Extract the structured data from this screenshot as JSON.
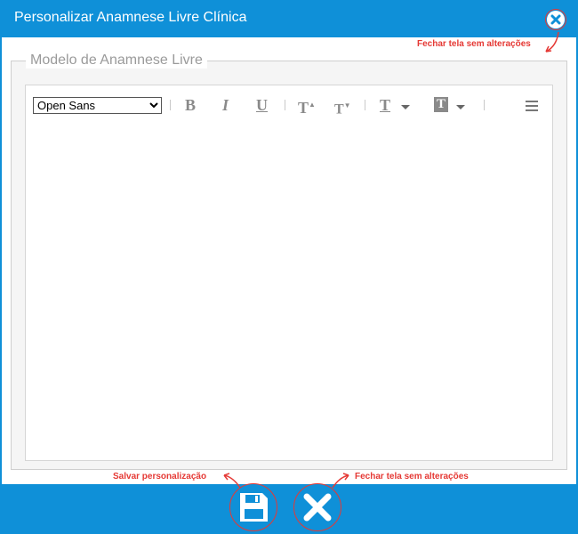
{
  "window": {
    "title": "Personalizar Anamnese Livre Clínica"
  },
  "fieldset": {
    "legend": "Modelo de Anamnese Livre"
  },
  "editor": {
    "font_selected": "Open Sans",
    "font_options": [
      "Open Sans"
    ],
    "content": ""
  },
  "annotations": {
    "close_top": "Fechar tela sem alterações",
    "save": "Salvar personalização",
    "close_bottom": "Fechar tela sem alterações"
  },
  "colors": {
    "primary": "#0f90d8",
    "annotation": "#e53935"
  }
}
